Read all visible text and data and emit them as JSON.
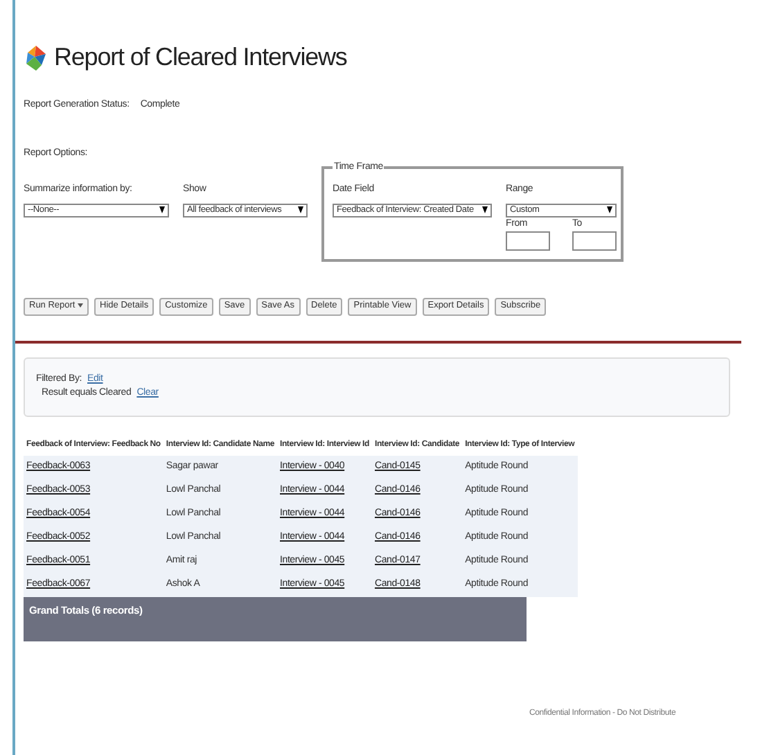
{
  "title": "Report of Cleared Interviews",
  "status": {
    "label": "Report Generation Status:",
    "value": "Complete"
  },
  "options_heading": "Report Options:",
  "summarize": {
    "label": "Summarize information by:",
    "value": "--None--"
  },
  "show": {
    "label": "Show",
    "value": "All feedback of interviews"
  },
  "time_frame": {
    "legend": "Time Frame",
    "date_field_label": "Date Field",
    "date_field_value": "Feedback of Interview: Created Date",
    "range_label": "Range",
    "range_value": "Custom",
    "from_label": "From",
    "to_label": "To"
  },
  "buttons": [
    {
      "label": "Run Report",
      "dropdown": true
    },
    {
      "label": "Hide Details",
      "dropdown": false
    },
    {
      "label": "Customize",
      "dropdown": false
    },
    {
      "label": "Save",
      "dropdown": false
    },
    {
      "label": "Save As",
      "dropdown": false
    },
    {
      "label": "Delete",
      "dropdown": false
    },
    {
      "label": "Printable View",
      "dropdown": false
    },
    {
      "label": "Export Details",
      "dropdown": false
    },
    {
      "label": "Subscribe",
      "dropdown": false
    }
  ],
  "filter": {
    "label": "Filtered By:",
    "edit": "Edit",
    "condition": "Result equals Cleared",
    "clear": "Clear"
  },
  "table": {
    "columns": [
      "Feedback of Interview: Feedback No",
      "Interview Id: Candidate Name",
      "Interview Id: Interview Id",
      "Interview Id: Candidate",
      "Interview Id: Type of Interview"
    ],
    "rows": [
      [
        "Feedback-0063",
        "Sagar pawar",
        "Interview - 0040",
        "Cand-0145",
        "Aptitude Round"
      ],
      [
        "Feedback-0053",
        "Lowl Panchal",
        "Interview - 0044",
        "Cand-0146",
        "Aptitude Round"
      ],
      [
        "Feedback-0054",
        "Lowl Panchal",
        "Interview - 0044",
        "Cand-0146",
        "Aptitude Round"
      ],
      [
        "Feedback-0052",
        "Lowl Panchal",
        "Interview - 0044",
        "Cand-0146",
        "Aptitude Round"
      ],
      [
        "Feedback-0051",
        "Amit raj",
        "Interview - 0045",
        "Cand-0147",
        "Aptitude Round"
      ],
      [
        "Feedback-0067",
        "Ashok A",
        "Interview - 0045",
        "Cand-0148",
        "Aptitude Round"
      ]
    ],
    "link_columns": [
      true,
      false,
      true,
      true,
      false
    ],
    "grand_total": "Grand Totals (6 records)"
  },
  "footer": "Confidential Information - Do Not Distribute"
}
